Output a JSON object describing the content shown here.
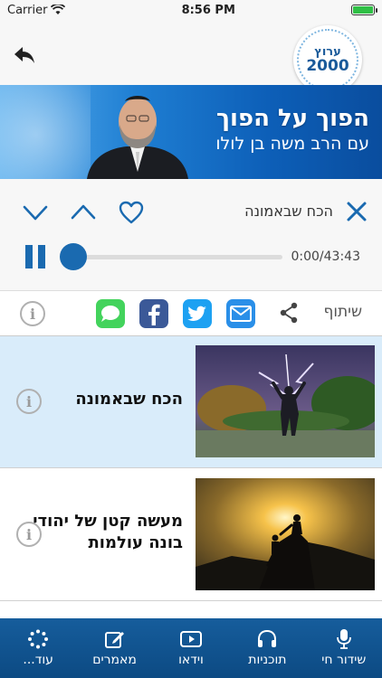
{
  "status": {
    "carrier": "Carrier",
    "time": "8:56 PM"
  },
  "logo": {
    "name": "ערוץ",
    "year": "2000"
  },
  "banner": {
    "title": "הפוך על הפוך",
    "subtitle": "עם הרב משה בן לולו"
  },
  "player": {
    "now_playing": "הכח שבאמונה",
    "time": "0:00/43:43",
    "progress": 0.0
  },
  "share": {
    "label": "שיתוף"
  },
  "items": [
    {
      "title": "הכח שבאמונה",
      "active": true
    },
    {
      "title": "מעשה קטן של יהודי בונה עולמות",
      "active": false
    }
  ],
  "tabs": [
    {
      "label": "שידור חי",
      "icon": "microphone-icon"
    },
    {
      "label": "תוכניות",
      "icon": "headphones-icon"
    },
    {
      "label": "וידאו",
      "icon": "video-play-icon"
    },
    {
      "label": "מאמרים",
      "icon": "edit-icon"
    },
    {
      "label": "עוד...",
      "icon": "more-dots-icon"
    }
  ],
  "colors": {
    "accent": "#1a6ab0",
    "tabbar": "#0c4a83",
    "active_row": "#d9ecfa"
  }
}
